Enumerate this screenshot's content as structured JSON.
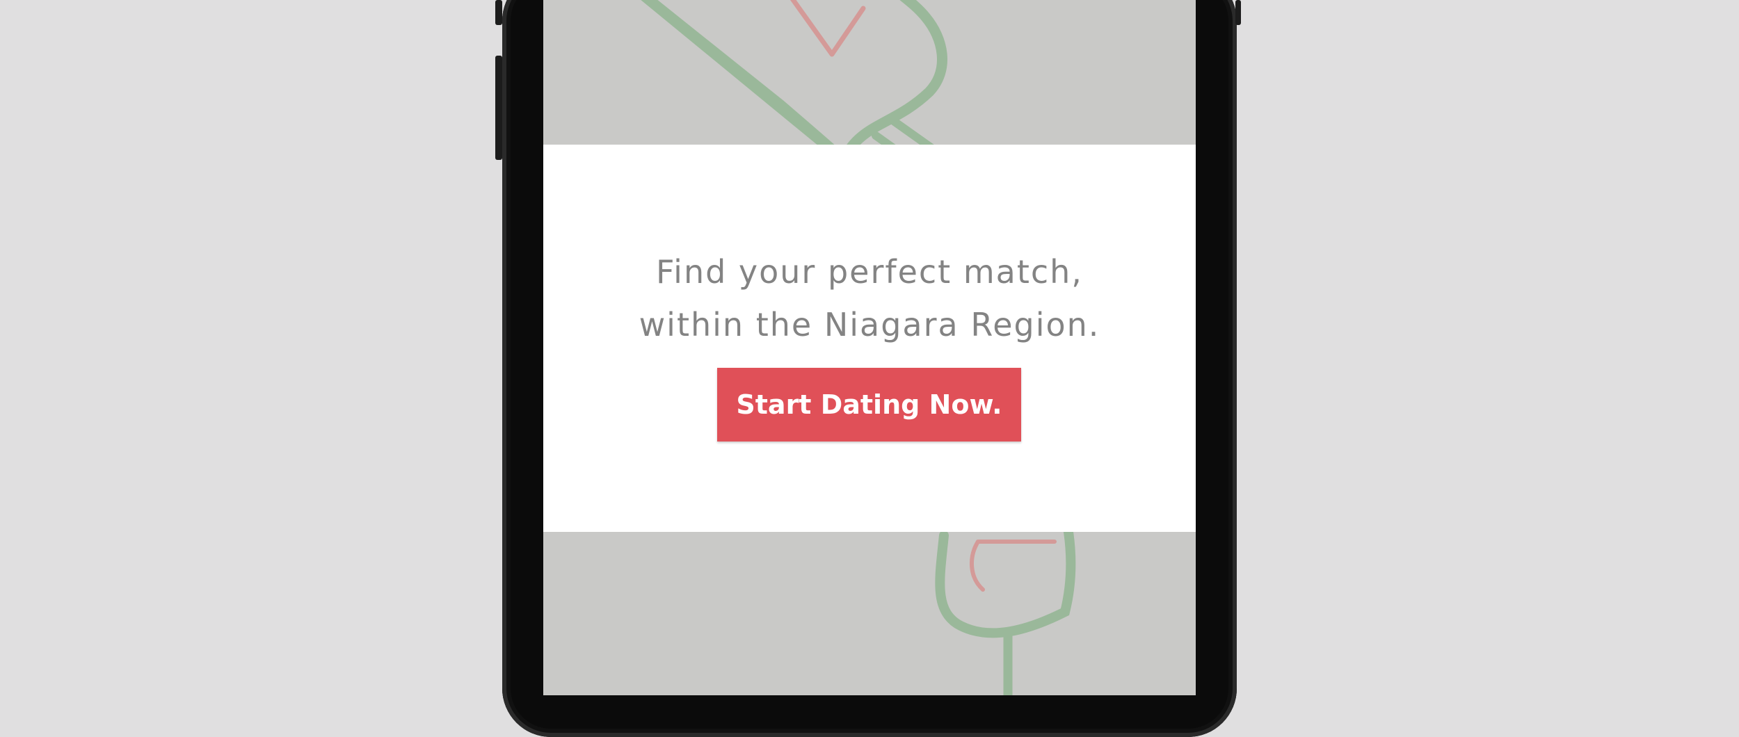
{
  "hero": {
    "headline_line1": "Find your perfect match,",
    "headline_line2": "within the Niagara Region.",
    "cta_label": "Start Dating Now."
  },
  "colors": {
    "background": "#e0dfe0",
    "screen": "#c9c9c7",
    "card": "#ffffff",
    "text": "#838383",
    "accent": "#e05058",
    "illustration_green": "#9ab89a",
    "illustration_red": "#d49a98"
  },
  "icons": [
    "wine-bottle-icon",
    "wine-glass-icon"
  ]
}
